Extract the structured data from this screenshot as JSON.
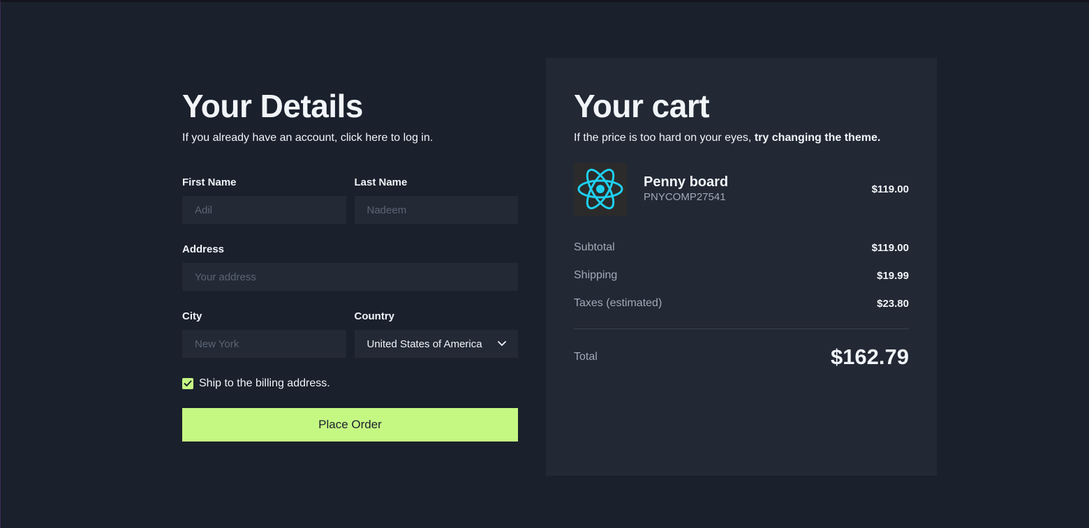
{
  "details": {
    "title": "Your Details",
    "subtitle": "If you already have an account, click here to log in.",
    "first_name": {
      "label": "First Name",
      "placeholder": "Adil"
    },
    "last_name": {
      "label": "Last Name",
      "placeholder": "Nadeem"
    },
    "address": {
      "label": "Address",
      "placeholder": "Your address"
    },
    "city": {
      "label": "City",
      "placeholder": "New York"
    },
    "country": {
      "label": "Country",
      "selected": "United States of America"
    },
    "ship_checkbox": {
      "label": "Ship to the billing address.",
      "checked": true
    },
    "place_order_label": "Place Order"
  },
  "cart": {
    "title": "Your cart",
    "subtitle_prefix": "If the price is too hard on your eyes, ",
    "subtitle_link": "try changing the theme.",
    "item": {
      "icon": "react-atom-icon",
      "name": "Penny board",
      "sku": "PNYCOMP27541",
      "price": "$119.00"
    },
    "lines": [
      {
        "label": "Subtotal",
        "value": "$119.00"
      },
      {
        "label": "Shipping",
        "value": "$19.99"
      },
      {
        "label": "Taxes (estimated)",
        "value": "$23.80"
      }
    ],
    "total": {
      "label": "Total",
      "value": "$162.79"
    }
  },
  "colors": {
    "background": "#1a202c",
    "panel": "#222834",
    "input": "#232a36",
    "accent": "#c5f883",
    "react_icon": "#1fd0f0"
  }
}
